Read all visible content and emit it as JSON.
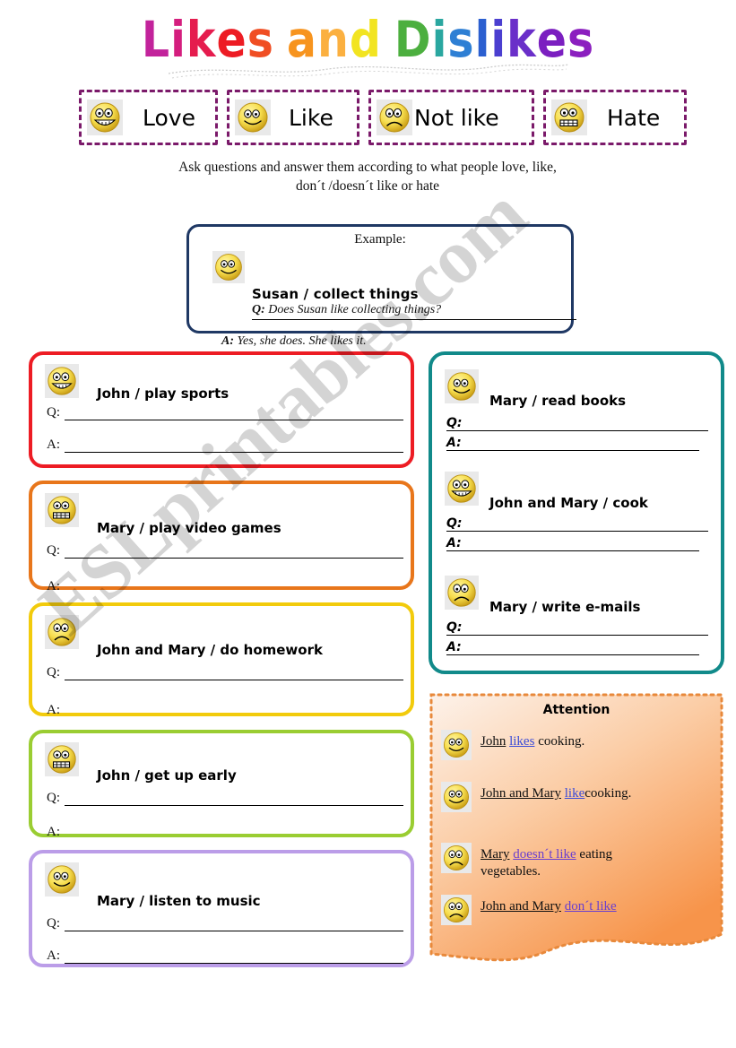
{
  "title": {
    "letters": [
      {
        "ch": "L",
        "color": "#C2239B"
      },
      {
        "ch": "i",
        "color": "#D41E7E"
      },
      {
        "ch": "k",
        "color": "#E51C4E"
      },
      {
        "ch": "e",
        "color": "#ED1C24"
      },
      {
        "ch": "s",
        "color": "#F04E23"
      },
      {
        "ch": "a",
        "color": "#F7941E"
      },
      {
        "ch": "n",
        "color": "#FBB040"
      },
      {
        "ch": "d",
        "color": "#F2E421"
      },
      {
        "ch": "D",
        "color": "#4CAF3F"
      },
      {
        "ch": "i",
        "color": "#2AA7A0"
      },
      {
        "ch": "s",
        "color": "#2E7FD4"
      },
      {
        "ch": "l",
        "color": "#2B5FD0"
      },
      {
        "ch": "i",
        "color": "#4B3FD0"
      },
      {
        "ch": "k",
        "color": "#6A2FC9"
      },
      {
        "ch": "e",
        "color": "#7B1FC0"
      },
      {
        "ch": "s",
        "color": "#8B1FBF"
      }
    ],
    "text": "Likes and Dislikes"
  },
  "legend": {
    "border_color": "#7B1A6A",
    "items": [
      {
        "label": "Love",
        "face": "grin-teeth-face",
        "mood": "love"
      },
      {
        "label": "Like",
        "face": "smile-face",
        "mood": "like"
      },
      {
        "label": "Not like",
        "face": "sad-face",
        "mood": "notlike"
      },
      {
        "label": "Hate",
        "face": "gritted-teeth-face",
        "mood": "hate"
      }
    ]
  },
  "instructions": {
    "line1": "Ask questions and answer them according to what people love, like,",
    "line2": "don´t /doesn´t like or hate"
  },
  "example": {
    "heading": "Example:",
    "face": "smile-face",
    "prompt": "Susan / collect things",
    "question_label": "Q:",
    "question": "Does Susan like collecting things?",
    "answer_label": "A:",
    "answer": "Yes, she does. She likes it."
  },
  "left_cards": [
    {
      "prompt": "John / play sports",
      "face": "grin-teeth-face",
      "mood": "love",
      "border_color": "#ED1C24",
      "q_label": "Q:",
      "a_label": "A:",
      "q_rule": true,
      "a_rule": true
    },
    {
      "prompt": "Mary / play video games",
      "face": "gritted-teeth-face",
      "mood": "hate",
      "border_color": "#E8761B",
      "q_label": "Q:",
      "a_label": "A:",
      "q_rule": true,
      "a_rule": false
    },
    {
      "prompt": "John and Mary / do homework",
      "face": "sad-face",
      "mood": "notlike",
      "border_color": "#F2CB0C",
      "q_label": "Q:",
      "a_label": "A:",
      "q_rule": true,
      "a_rule": false
    },
    {
      "prompt": "John / get up early",
      "face": "gritted-teeth-face",
      "mood": "hate",
      "border_color": "#9ACD32",
      "q_label": "Q:",
      "a_label": "A:",
      "q_rule": true,
      "a_rule": false
    },
    {
      "prompt": "Mary / listen to music",
      "face": "smile-face",
      "mood": "like",
      "border_color": "#BB9DE8",
      "q_label": "Q:",
      "a_label": "A:",
      "q_rule": true,
      "a_rule": true
    }
  ],
  "right_panel": {
    "border_color": "#118A8A",
    "items": [
      {
        "prompt": "Mary / read books",
        "face": "smile-face",
        "mood": "like",
        "q_label": "Q:",
        "a_label": "A:"
      },
      {
        "prompt": "John and Mary / cook",
        "face": "grin-teeth-face",
        "mood": "love",
        "q_label": "Q:",
        "a_label": "A:"
      },
      {
        "prompt": "Mary / write e-mails",
        "face": "sad-face",
        "mood": "notlike",
        "q_label": "Q:",
        "a_label": "A:"
      }
    ]
  },
  "attention": {
    "title": "Attention",
    "border_color": "#E8893B",
    "rows": [
      {
        "face": "smile-face",
        "mood": "like",
        "subject": "John",
        "verb": "likes",
        "rest": " cooking."
      },
      {
        "face": "smile-face",
        "mood": "like",
        "subject": "John and Mary",
        "verb": "like",
        "rest": "cooking."
      },
      {
        "face": "sad-face",
        "mood": "notlike",
        "subject": "Mary",
        "verb": "doesn´t like",
        "rest": " eating vegetables."
      },
      {
        "face": "sad-face",
        "mood": "notlike",
        "subject": " John and Mary",
        "verb": "don´t like",
        "rest": ""
      }
    ]
  },
  "watermark": {
    "text": "ESLprintables.com"
  }
}
